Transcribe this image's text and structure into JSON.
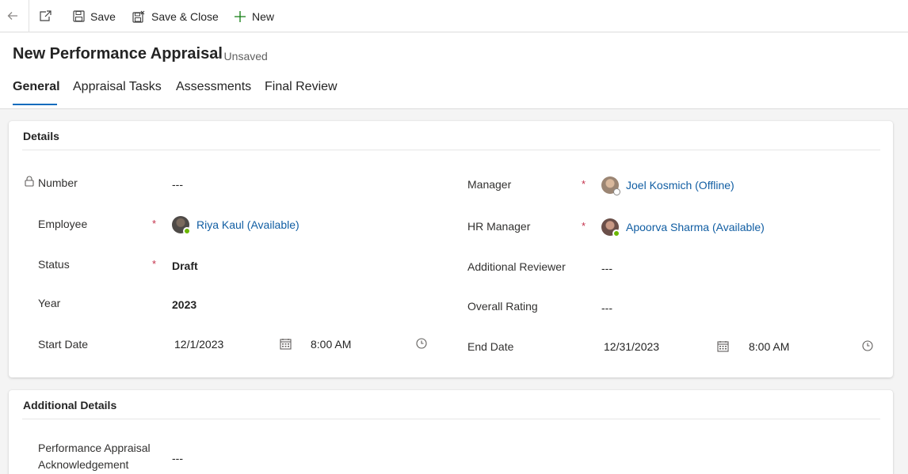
{
  "command_bar": {
    "save_label": "Save",
    "save_close_label": "Save & Close",
    "new_label": "New"
  },
  "header": {
    "title": "New Performance Appraisal",
    "status": "- Unsaved",
    "tabs": [
      {
        "label": "General",
        "active": true
      },
      {
        "label": "Appraisal Tasks",
        "active": false
      },
      {
        "label": "Assessments",
        "active": false
      },
      {
        "label": "Final Review",
        "active": false
      }
    ]
  },
  "details": {
    "section_title": "Details",
    "number": {
      "label": "Number",
      "value": "---"
    },
    "employee": {
      "label": "Employee",
      "required": "*",
      "value": "Riya Kaul (Available)"
    },
    "status": {
      "label": "Status",
      "required": "*",
      "value": "Draft"
    },
    "year": {
      "label": "Year",
      "value": "2023"
    },
    "start_date": {
      "label": "Start Date",
      "date": "12/1/2023",
      "time": "8:00 AM"
    },
    "manager": {
      "label": "Manager",
      "required": "*",
      "value": "Joel Kosmich (Offline)"
    },
    "hr_manager": {
      "label": "HR Manager",
      "required": "*",
      "value": "Apoorva Sharma (Available)"
    },
    "additional_reviewer": {
      "label": "Additional Reviewer",
      "value": "---"
    },
    "overall_rating": {
      "label": "Overall Rating",
      "value": "---"
    },
    "end_date": {
      "label": "End Date",
      "date": "12/31/2023",
      "time": "8:00 AM"
    }
  },
  "additional_details": {
    "section_title": "Additional Details",
    "acknowledgement": {
      "label_line1": "Performance Appraisal",
      "label_line2": "Acknowledgement",
      "value": "---"
    }
  },
  "colors": {
    "accent": "#0f6cbd",
    "link": "#115ea3",
    "required": "#c4314b",
    "available": "#6bb700"
  }
}
